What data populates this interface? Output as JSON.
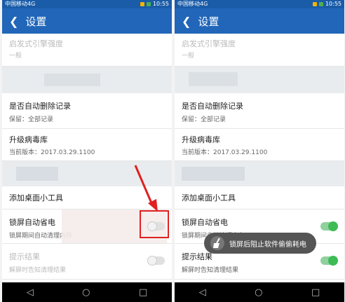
{
  "status": {
    "carrier": "中国移动4G",
    "time": "10:55"
  },
  "appbar": {
    "title": "设置"
  },
  "settings": {
    "engine": {
      "title": "启发式引擎强度",
      "sub": "一般"
    },
    "auto_delete": {
      "title": "是否自动删除记录",
      "sub": "保留：全部记录"
    },
    "upgrade": {
      "title": "升级病毒库",
      "sub": "当前版本：2017.03.29.1100"
    },
    "widget": {
      "title": "添加桌面小工具"
    },
    "lock_save": {
      "title": "锁屏自动省电",
      "sub": "锁屏期间自动清理内存"
    },
    "prompt": {
      "title": "提示结果",
      "sub": "解屏时告知清理结果"
    }
  },
  "left_state": {
    "lock_save_on": false,
    "prompt_on": false
  },
  "right_state": {
    "lock_save_on": true,
    "prompt_on": true
  },
  "toast": {
    "text": "锁屏后阻止软件偷偷耗电"
  },
  "colors": {
    "primary": "#2166b9",
    "toggle_on": "#3dbb55",
    "annotation": "#e02020"
  },
  "nav_icons": [
    "back-triangle-icon",
    "home-circle-icon",
    "recent-square-icon"
  ]
}
